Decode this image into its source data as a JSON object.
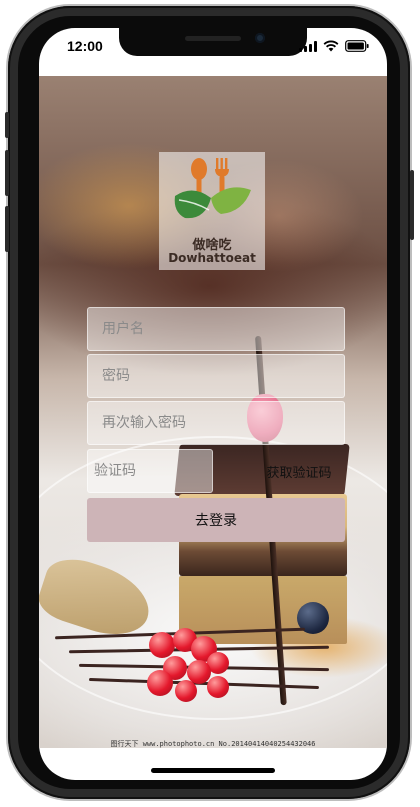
{
  "status_bar": {
    "time": "12:00"
  },
  "logo": {
    "name_zh": "做啥吃",
    "name_en": "Dowhattoeat"
  },
  "form": {
    "username_placeholder": "用户名",
    "password_placeholder": "密码",
    "confirm_password_placeholder": "再次输入密码",
    "code_placeholder": "验证码",
    "get_code_label": "获取验证码",
    "submit_label": "去登录"
  },
  "footer": {
    "watermark": "图行天下 www.photophoto.cn  No.20140414040254432046"
  },
  "colors": {
    "login_button": "#cdb4b7",
    "logo_orange": "#e07a2a",
    "logo_green": "#3c8a3a"
  },
  "icons": [
    "signal-icon",
    "wifi-icon",
    "battery-icon",
    "spoon-icon",
    "fork-icon",
    "leaf-icon"
  ]
}
